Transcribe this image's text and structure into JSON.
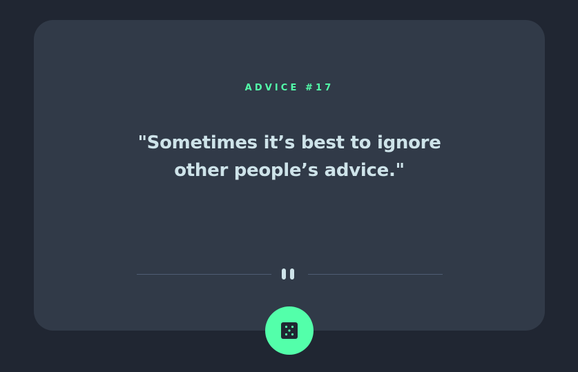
{
  "card": {
    "advice_id": "ADVICE #17",
    "advice_text": "\"Sometimes it’s best to ignore other people’s advice.\""
  },
  "divider": {
    "icon": "pause-icon"
  },
  "dice_button": {
    "icon": "dice-icon"
  },
  "colors": {
    "background": "#202632",
    "card": "#313a48",
    "accent": "#53ffaa",
    "text": "#cee3e9",
    "divider": "#4f5d74"
  }
}
